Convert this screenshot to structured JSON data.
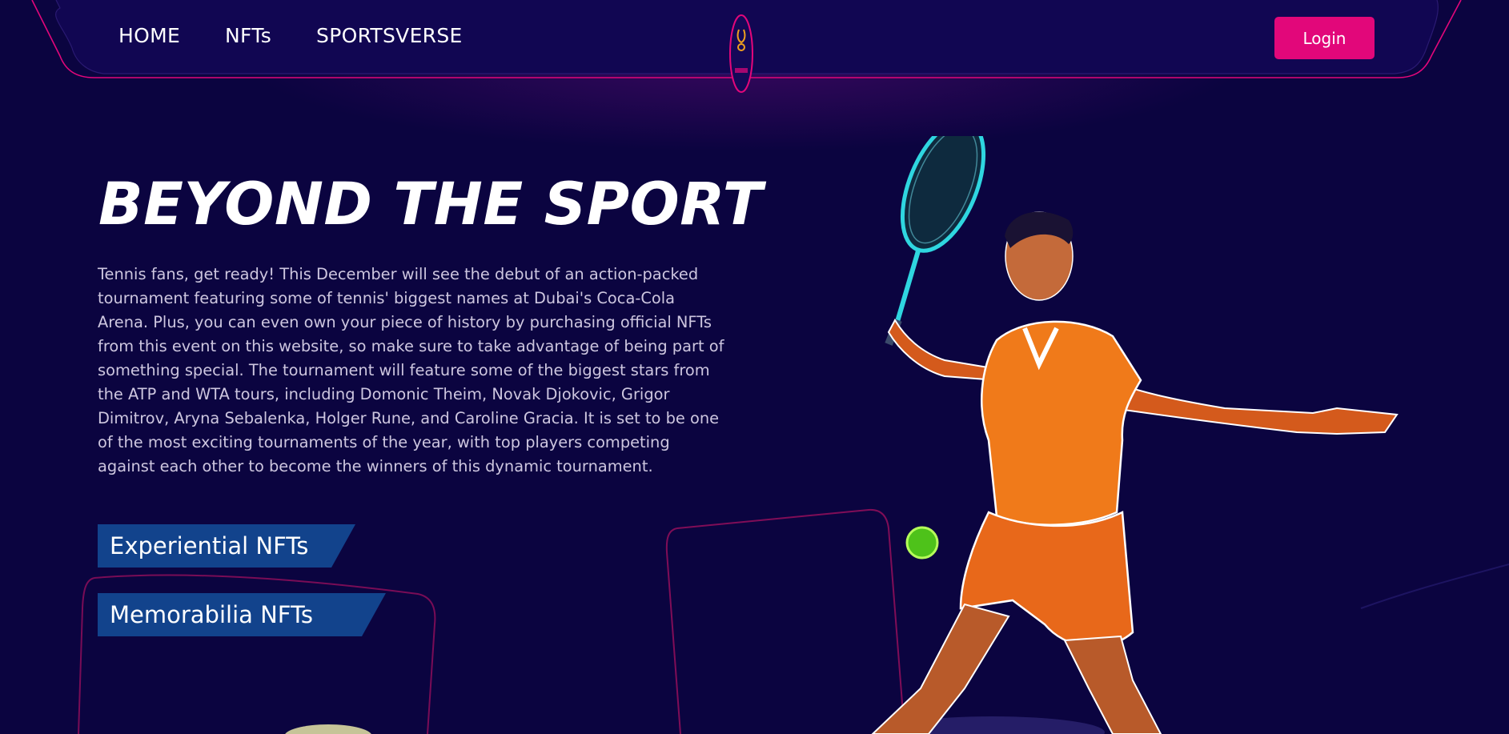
{
  "nav": {
    "links": [
      "HOME",
      "NFTs",
      "SPORTSVERSE"
    ],
    "login_label": "Login"
  },
  "hero": {
    "title": "BEYOND THE SPORT",
    "description": "Tennis fans, get ready! This December will see the debut of an action-packed tournament featuring some of tennis' biggest names at Dubai's Coca-Cola Arena. Plus, you can even own your piece of history by purchasing official NFTs from this event on this website, so make sure to take advantage of being part of something special. The tournament will feature some of the biggest stars from the ATP and WTA tours, including Domonic Theim, Novak Djokovic, Grigor Dimitrov, Aryna Sebalenka, Holger Rune, and Caroline Gracia. It is set to be one of the most exciting tournaments of the year, with top players competing against each other to become the winners of this dynamic tournament.",
    "tags": [
      "Experiential NFTs",
      "Memorabilia NFTs"
    ]
  },
  "colors": {
    "background": "#0b0440",
    "accent": "#e2077a",
    "tag_background": "#12438c",
    "body_text": "#cdc6df"
  },
  "icons": {
    "logo": "brand-logo-icon"
  }
}
